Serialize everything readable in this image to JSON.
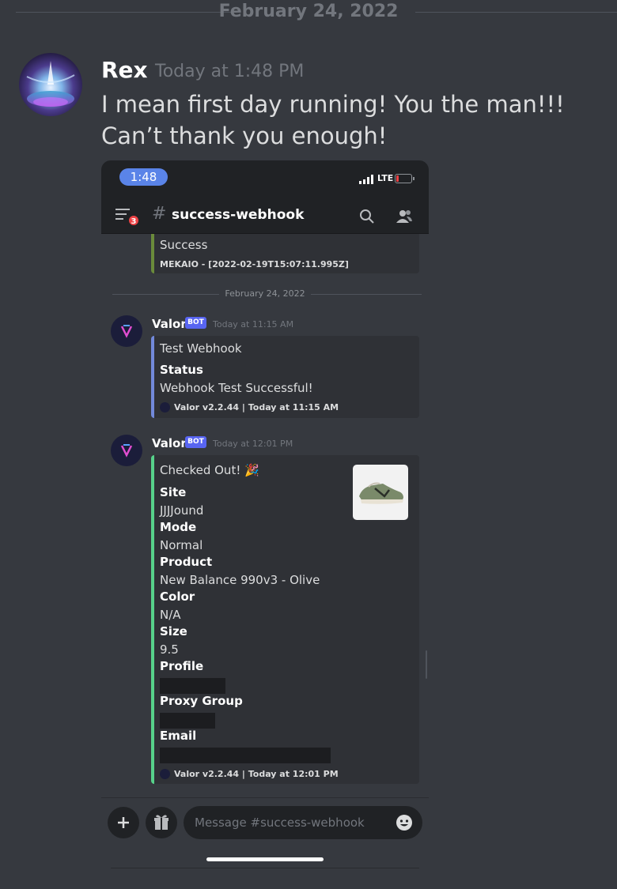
{
  "date_divider": "February 24, 2022",
  "message": {
    "author": "Rex",
    "timestamp": "Today at 1:48 PM",
    "text": "I mean first day running! You the man!!! Can’t thank you enough!"
  },
  "phone": {
    "status_time": "1:48",
    "network": "LTE",
    "channel_icon": "#",
    "channel_name": "success-webhook",
    "menu_badge": "3",
    "icons": {
      "menu": "menu-icon",
      "search": "search-icon",
      "members": "members-icon",
      "add": "plus-icon",
      "gift": "gift-icon",
      "emoji": "emoji-icon"
    },
    "colors": {
      "bar_success": "#6a8b3b",
      "bar_test": "#7289da",
      "bar_checkout": "#57d18a",
      "blurple": "#5865f2",
      "pill": "#5a84e8"
    },
    "partial_embed": {
      "text": "Success",
      "footer": "MEKAIO - [2022-02-19T15:07:11.995Z]"
    },
    "inner_date": "February 24, 2022",
    "messages": [
      {
        "author": "Valor",
        "tag": "BOT",
        "time": "Today at 11:15 AM",
        "embed": {
          "title": "Test Webhook",
          "fields": [
            {
              "name": "Status",
              "value": "Webhook Test Successful!"
            }
          ],
          "footer": "Valor v2.2.44 | Today at 11:15 AM"
        }
      },
      {
        "author": "Valor",
        "tag": "BOT",
        "time": "Today at 12:01 PM",
        "embed": {
          "title": "Checked Out! 🎉",
          "fields": [
            {
              "name": "Site",
              "value": "JJJJound"
            },
            {
              "name": "Mode",
              "value": "Normal"
            },
            {
              "name": "Product",
              "value": "New Balance 990v3 - Olive"
            },
            {
              "name": "Color",
              "value": "N/A"
            },
            {
              "name": "Size",
              "value": "9.5"
            },
            {
              "name": "Profile",
              "value": ""
            },
            {
              "name": "Proxy Group",
              "value": ""
            },
            {
              "name": "Email",
              "value": ""
            }
          ],
          "footer": "Valor v2.2.44 | Today at 12:01 PM"
        }
      }
    ],
    "composer_placeholder": "Message #success-webhook"
  }
}
